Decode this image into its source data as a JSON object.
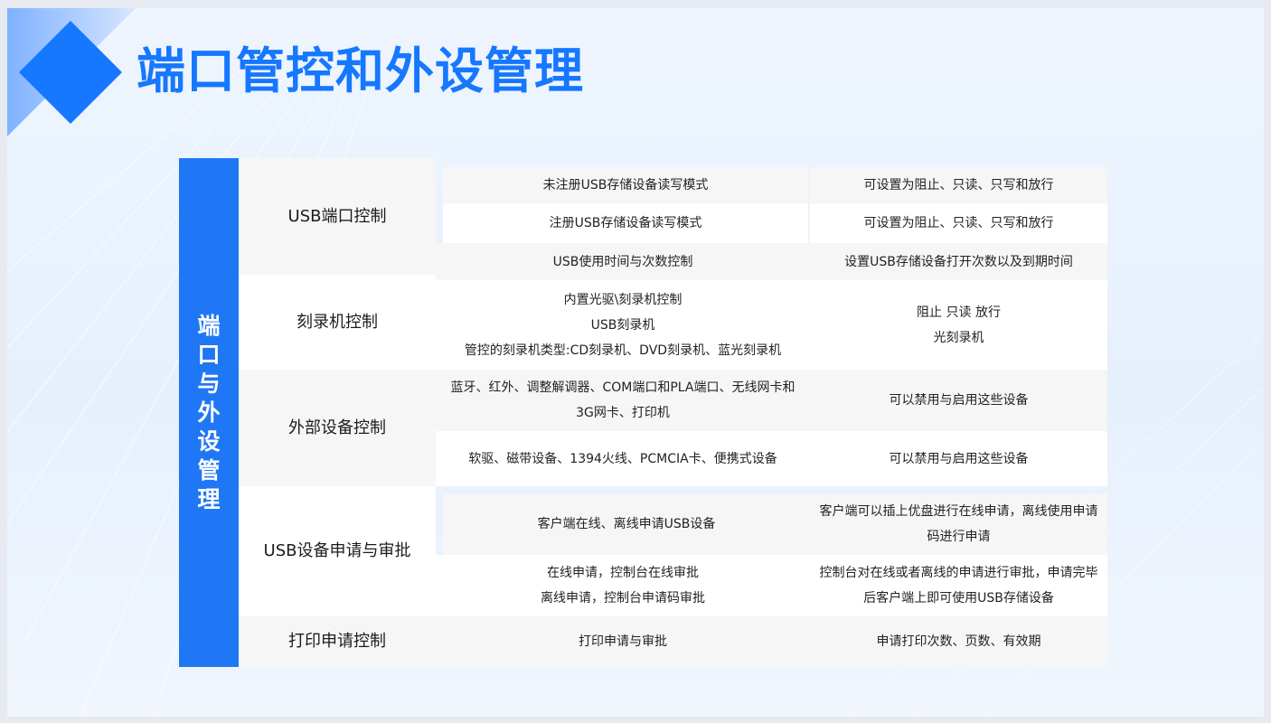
{
  "page": {
    "title": "端口管控和外设管理"
  },
  "sidebar": {
    "label": "端口与外设管理"
  },
  "table": {
    "usb_port": {
      "category": "USB端口控制",
      "rows": [
        {
          "feature": "未注册USB存储设备读写模式",
          "desc": "可设置为阻止、只读、只写和放行"
        },
        {
          "feature": "注册USB存储设备读写模式",
          "desc": "可设置为阻止、只读、只写和放行"
        },
        {
          "feature": "USB使用时间与次数控制",
          "desc": "设置USB存储设备打开次数以及到期时间"
        }
      ]
    },
    "burner": {
      "category": "刻录机控制",
      "feature_lines": [
        "内置光驱\\刻录机控制",
        "USB刻录机",
        "管控的刻录机类型:CD刻录机、DVD刻录机、蓝光刻录机"
      ],
      "desc_lines": [
        "阻止 只读 放行",
        "光刻录机"
      ]
    },
    "external": {
      "category": "外部设备控制",
      "rows": [
        {
          "feature": "蓝牙、红外、调整解调器、COM端口和PLA端口、无线网卡和3G网卡、打印机",
          "desc": "可以禁用与启用这些设备"
        },
        {
          "feature": "软驱、磁带设备、1394火线、PCMCIA卡、便携式设备",
          "desc": "可以禁用与启用这些设备"
        }
      ]
    },
    "usb_request": {
      "category": "USB设备申请与审批",
      "rows": [
        {
          "feature_lines": [
            "客户端在线、离线申请USB设备"
          ],
          "desc": "客户端可以插上优盘进行在线申请，离线使用申请码进行申请"
        },
        {
          "feature_lines": [
            "在线申请，控制台在线审批",
            "离线申请，控制台申请码审批"
          ],
          "desc": "控制台对在线或者离线的申请进行审批，申请完毕后客户端上即可使用USB存储设备"
        }
      ]
    },
    "print": {
      "category": "打印申请控制",
      "feature": "打印申请与审批",
      "desc": "申请打印次数、页数、有效期"
    }
  },
  "colors": {
    "accent": "#1677ff",
    "band": "#1f77f5",
    "row_alt": "#f6f6f6",
    "row": "#ffffff"
  }
}
